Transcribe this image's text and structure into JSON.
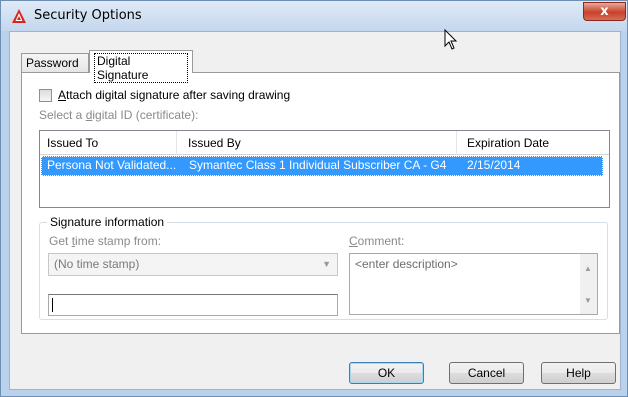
{
  "window": {
    "title": "Security Options",
    "close_label": "x"
  },
  "tabs": [
    {
      "label": "Password"
    },
    {
      "label": "Digital Signature"
    }
  ],
  "attach": {
    "label_pre": "",
    "label_mnemonic": "A",
    "label_post": "ttach digital signature after saving drawing",
    "checked": false
  },
  "select_id": {
    "pre": "Select a ",
    "mnemonic": "d",
    "post": "igital ID (certificate):"
  },
  "certificates": {
    "columns": [
      "Issued To",
      "Issued By",
      "Expiration Date"
    ],
    "rows": [
      {
        "issued_to": "Persona Not Validated...",
        "issued_by": "Symantec Class 1 Individual Subscriber CA - G4",
        "expiration": "2/15/2014",
        "selected": true
      }
    ]
  },
  "signature_info": {
    "title": "Signature information",
    "timestamp_label_pre": "Get ",
    "timestamp_label_mnemonic": "t",
    "timestamp_label_post": "ime stamp from:",
    "timestamp_value": "(No time stamp)",
    "comment_label_mnemonic": "C",
    "comment_label_post": "omment:",
    "comment_placeholder": "<enter description>"
  },
  "buttons": {
    "ok": "OK",
    "cancel": "Cancel",
    "help": "Help"
  },
  "colors": {
    "selection": "#3399ff",
    "titlebar": "#c4d7ee",
    "close": "#c7412a"
  }
}
